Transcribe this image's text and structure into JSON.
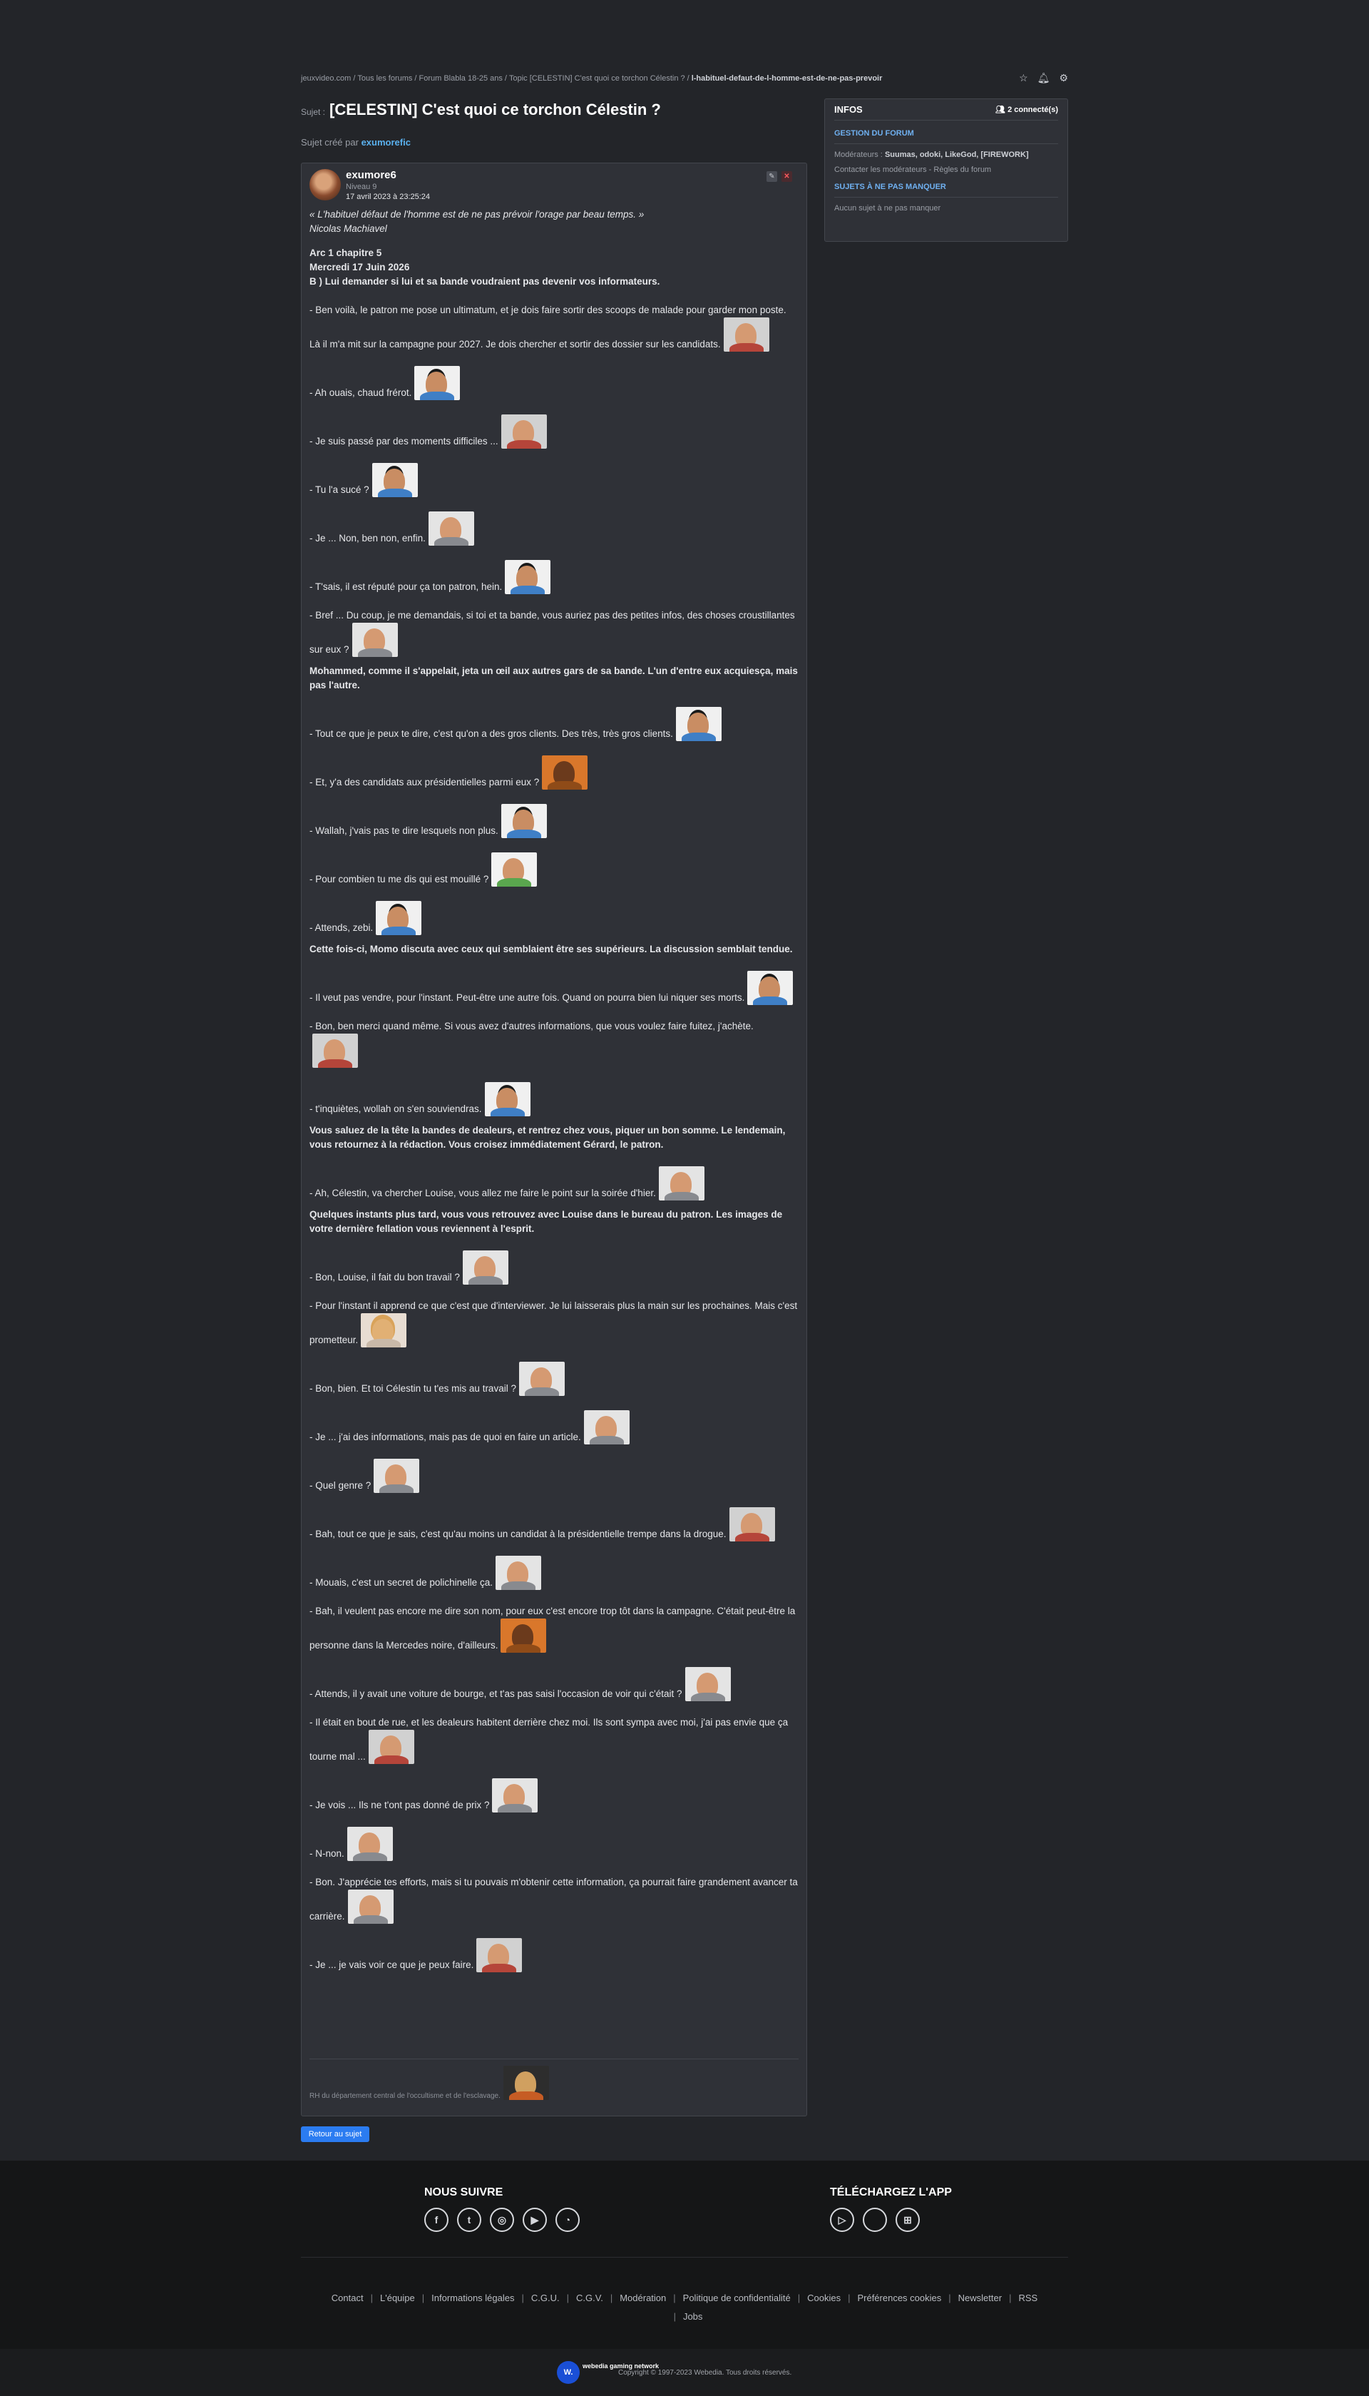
{
  "breadcrumb": {
    "items": [
      "jeuxvideo.com",
      "Tous les forums",
      "Forum Blabla 18-25 ans",
      "Topic [CELESTIN] C'est quoi ce torchon Célestin ?"
    ],
    "last": "l-habituel-defaut-de-l-homme-est-de-ne-pas-prevoir",
    "sep": "/"
  },
  "topic": {
    "prefix": "Sujet :",
    "title": "[CELESTIN] C'est quoi ce torchon Célestin ?",
    "created_label": "Sujet créé par",
    "created_by": "exumorefic"
  },
  "post": {
    "author": "exumore6",
    "level": "Niveau 9",
    "date": "17 avril 2023 à 23:25:24",
    "edit_icon": "pencil-icon",
    "delete_icon": "close-icon",
    "quote": "« L'habituel défaut de l'homme est de ne pas prévoir l'orage par beau temps. »",
    "quote_author": "Nicolas Machiavel",
    "heading1": "Arc 1 chapitre 5",
    "heading2": "Mercredi 17 Juin 2026",
    "heading3": "B ) Lui demander si lui et sa bande voudraient pas devenir vos informateurs.",
    "signature": "RH du département central de l'occultisme et de l'esclavage."
  },
  "lines": [
    {
      "text": "- Ben voilà, le patron me pose un ultimatum, et je dois faire sortir des scoops de malade pour garder mon poste. Là il m'a mit sur la campagne pour 2027. Je dois chercher et sortir des dossier sur les candidats.",
      "bold": false,
      "sticker": "s-red"
    },
    {
      "text": "- Ah ouais, chaud frérot.",
      "bold": false,
      "sticker": "s-blue"
    },
    {
      "text": "- Je suis passé par des moments difficiles ...",
      "bold": false,
      "sticker": "s-red"
    },
    {
      "text": "- Tu l'a sucé ?",
      "bold": false,
      "sticker": "s-blue"
    },
    {
      "text": "- Je ... Non, ben non, enfin.",
      "bold": false,
      "sticker": "s-grey"
    },
    {
      "text": "- T'sais, il est réputé pour ça ton patron, hein.",
      "bold": false,
      "sticker": "s-blue"
    },
    {
      "text": "- Bref ... Du coup, je me demandais, si toi et ta bande, vous auriez pas des petites infos, des choses croustillantes sur eux ?",
      "bold": false,
      "sticker": "s-grey"
    },
    {
      "text": "Mohammed, comme il s'appelait, jeta un œil aux autres gars de sa bande. L'un d'entre eux acquiesça, mais pas l'autre.",
      "bold": true,
      "sticker": ""
    },
    {
      "text": "- Tout ce que je peux te dire, c'est qu'on a des gros clients. Des très, très gros clients.",
      "bold": false,
      "sticker": "s-blue"
    },
    {
      "text": "- Et, y'a des candidats aux présidentielles parmi eux ?",
      "bold": false,
      "sticker": "s-orange"
    },
    {
      "text": "- Wallah, j'vais pas te dire lesquels non plus.",
      "bold": false,
      "sticker": "s-blue"
    },
    {
      "text": "- Pour combien tu me dis qui est mouillé ?",
      "bold": false,
      "sticker": "s-green"
    },
    {
      "text": "- Attends, zebi.",
      "bold": false,
      "sticker": "s-blue"
    },
    {
      "text": "Cette fois-ci, Momo discuta avec ceux qui semblaient être ses supérieurs. La discussion semblait tendue.",
      "bold": true,
      "sticker": ""
    },
    {
      "text": "- Il veut pas vendre, pour l'instant. Peut-être une autre fois. Quand on pourra bien lui niquer ses morts.",
      "bold": false,
      "sticker": "s-blue"
    },
    {
      "text": "- Bon, ben merci quand même. Si vous avez d'autres informations, que vous voulez faire fuitez, j'achète.",
      "bold": false,
      "sticker": "s-red"
    },
    {
      "text": "- t'inquiètes, wollah on s'en souviendras.",
      "bold": false,
      "sticker": "s-blue"
    },
    {
      "text": "Vous saluez de la tête la bandes de dealeurs, et rentrez chez vous, piquer un bon somme. Le lendemain, vous retournez à la rédaction. Vous croisez immédiatement Gérard, le patron.",
      "bold": true,
      "sticker": ""
    },
    {
      "text": "- Ah, Célestin, va chercher Louise, vous allez me faire le point sur la soirée d'hier.",
      "bold": false,
      "sticker": "s-grey"
    },
    {
      "text": "Quelques instants plus tard, vous vous retrouvez avec Louise dans le bureau du patron. Les images de votre dernière fellation vous reviennent à l'esprit.",
      "bold": true,
      "sticker": ""
    },
    {
      "text": "- Bon, Louise, il fait du bon travail ?",
      "bold": false,
      "sticker": "s-grey"
    },
    {
      "text": "- Pour l'instant il apprend ce que c'est que d'interviewer. Je lui laisserais plus la main sur les prochaines. Mais c'est prometteur.",
      "bold": false,
      "sticker": "s-blonde"
    },
    {
      "text": "- Bon, bien. Et toi Célestin tu t'es mis au travail ?",
      "bold": false,
      "sticker": "s-grey"
    },
    {
      "text": "- Je ... j'ai des informations, mais pas de quoi en faire un article.",
      "bold": false,
      "sticker": "s-grey"
    },
    {
      "text": "- Quel genre ?",
      "bold": false,
      "sticker": "s-grey"
    },
    {
      "text": "- Bah, tout ce que je sais, c'est qu'au moins un candidat à la présidentielle trempe dans la drogue.",
      "bold": false,
      "sticker": "s-red"
    },
    {
      "text": "- Mouais, c'est un secret de polichinelle ça.",
      "bold": false,
      "sticker": "s-grey"
    },
    {
      "text": "- Bah, il veulent pas encore me dire son nom, pour eux c'est encore trop tôt dans la campagne. C'était peut-être la personne dans la Mercedes noire, d'ailleurs.",
      "bold": false,
      "sticker": "s-orange"
    },
    {
      "text": "- Attends, il y avait une voiture de bourge, et t'as pas saisi l'occasion de voir qui c'était ?",
      "bold": false,
      "sticker": "s-grey"
    },
    {
      "text": "- Il était en bout de rue, et les dealeurs habitent derrière chez moi. Ils sont sympa avec moi, j'ai pas envie que ça tourne mal ...",
      "bold": false,
      "sticker": "s-red"
    },
    {
      "text": "- Je vois ... Ils ne t'ont pas donné de prix ?",
      "bold": false,
      "sticker": "s-grey"
    },
    {
      "text": "- N-non.",
      "bold": false,
      "sticker": "s-grey"
    },
    {
      "text": "- Bon. J'apprécie tes efforts, mais si tu pouvais m'obtenir cette information, ça pourrait faire grandement avancer ta carrière.",
      "bold": false,
      "sticker": "s-grey"
    },
    {
      "text": "- Je ... je vais voir ce que je peux faire.",
      "bold": false,
      "sticker": "s-red"
    }
  ],
  "back_button": "Retour au sujet",
  "sidebar": {
    "title": "INFOS",
    "online": "2 connecté(s)",
    "online_icon": "users-icon",
    "section1": "GESTION DU FORUM",
    "moderators_label": "Modérateurs :",
    "moderators": "Suumas, odoki, LikeGod, [FIREWORK]",
    "contact": "Contacter les modérateurs - Règles du forum",
    "section2": "SUJETS À NE PAS MANQUER",
    "none": "Aucun sujet à ne pas manquer"
  },
  "footer": {
    "follow_title": "NOUS SUIVRE",
    "follow_icons": [
      "facebook-icon",
      "twitter-icon",
      "instagram-icon",
      "youtube-icon",
      "rss-icon"
    ],
    "app_title": "TÉLÉCHARGEZ L'APP",
    "app_icons": [
      "google-play-icon",
      "apple-icon",
      "windows-icon"
    ],
    "links": [
      "Contact",
      "L'équipe",
      "Informations légales",
      "C.G.U.",
      "C.G.V.",
      "Modération",
      "Politique de confidentialité",
      "Cookies",
      "Préférences cookies",
      "Newsletter",
      "RSS",
      "Jobs"
    ],
    "logo": "W.",
    "brand": "webedia gaming network",
    "copyright": "Copyright © 1997-2023 Webedia. Tous droits réservés."
  }
}
